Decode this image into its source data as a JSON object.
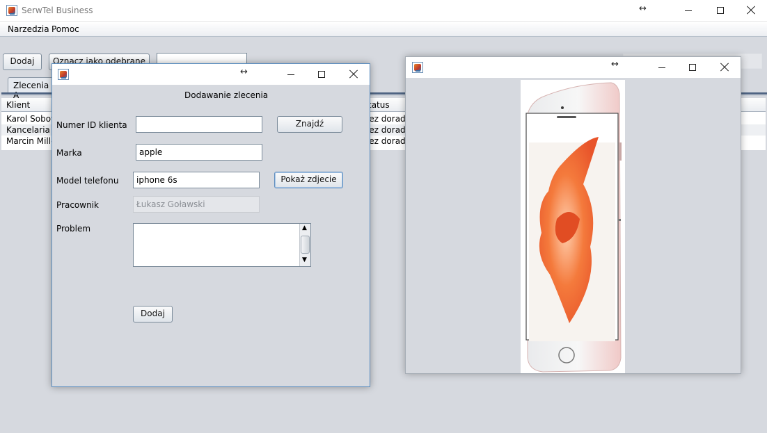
{
  "main_window": {
    "title": "SerwTel Business",
    "menu": [
      "Narzedzia",
      "Pomoc"
    ],
    "toolbar": {
      "add_label": "Dodaj",
      "mark_received_label": "Oznacz jako odebrane"
    },
    "tab_label": "Zlecenia A",
    "table": {
      "columns": [
        "Klient",
        "tatus"
      ],
      "rows": [
        [
          "Karol Sobot",
          "zez dorad"
        ],
        [
          "Kancelaria a",
          "zez dorad"
        ],
        [
          "Marcin Mille",
          "zez dorad"
        ]
      ]
    }
  },
  "dialog": {
    "heading": "Dodawanie zlecenia",
    "fields": {
      "client_id": {
        "label": "Numer ID klienta",
        "value": ""
      },
      "brand": {
        "label": "Marka",
        "value": "apple"
      },
      "model": {
        "label": "Model telefonu",
        "value": "iphone 6s"
      },
      "worker": {
        "label": "Pracownik",
        "value": "Łukasz Goławski"
      },
      "problem": {
        "label": "Problem",
        "value": ""
      }
    },
    "buttons": {
      "find": "Znajdź",
      "show_photo": "Pokaż zdjecie",
      "add": "Dodaj"
    }
  },
  "image_window": {
    "title": ""
  },
  "icons": [
    "java-app-icon",
    "minimize-icon",
    "maximize-icon",
    "close-icon",
    "resize-arrow-icon",
    "scroll-up-icon",
    "scroll-down-icon"
  ]
}
